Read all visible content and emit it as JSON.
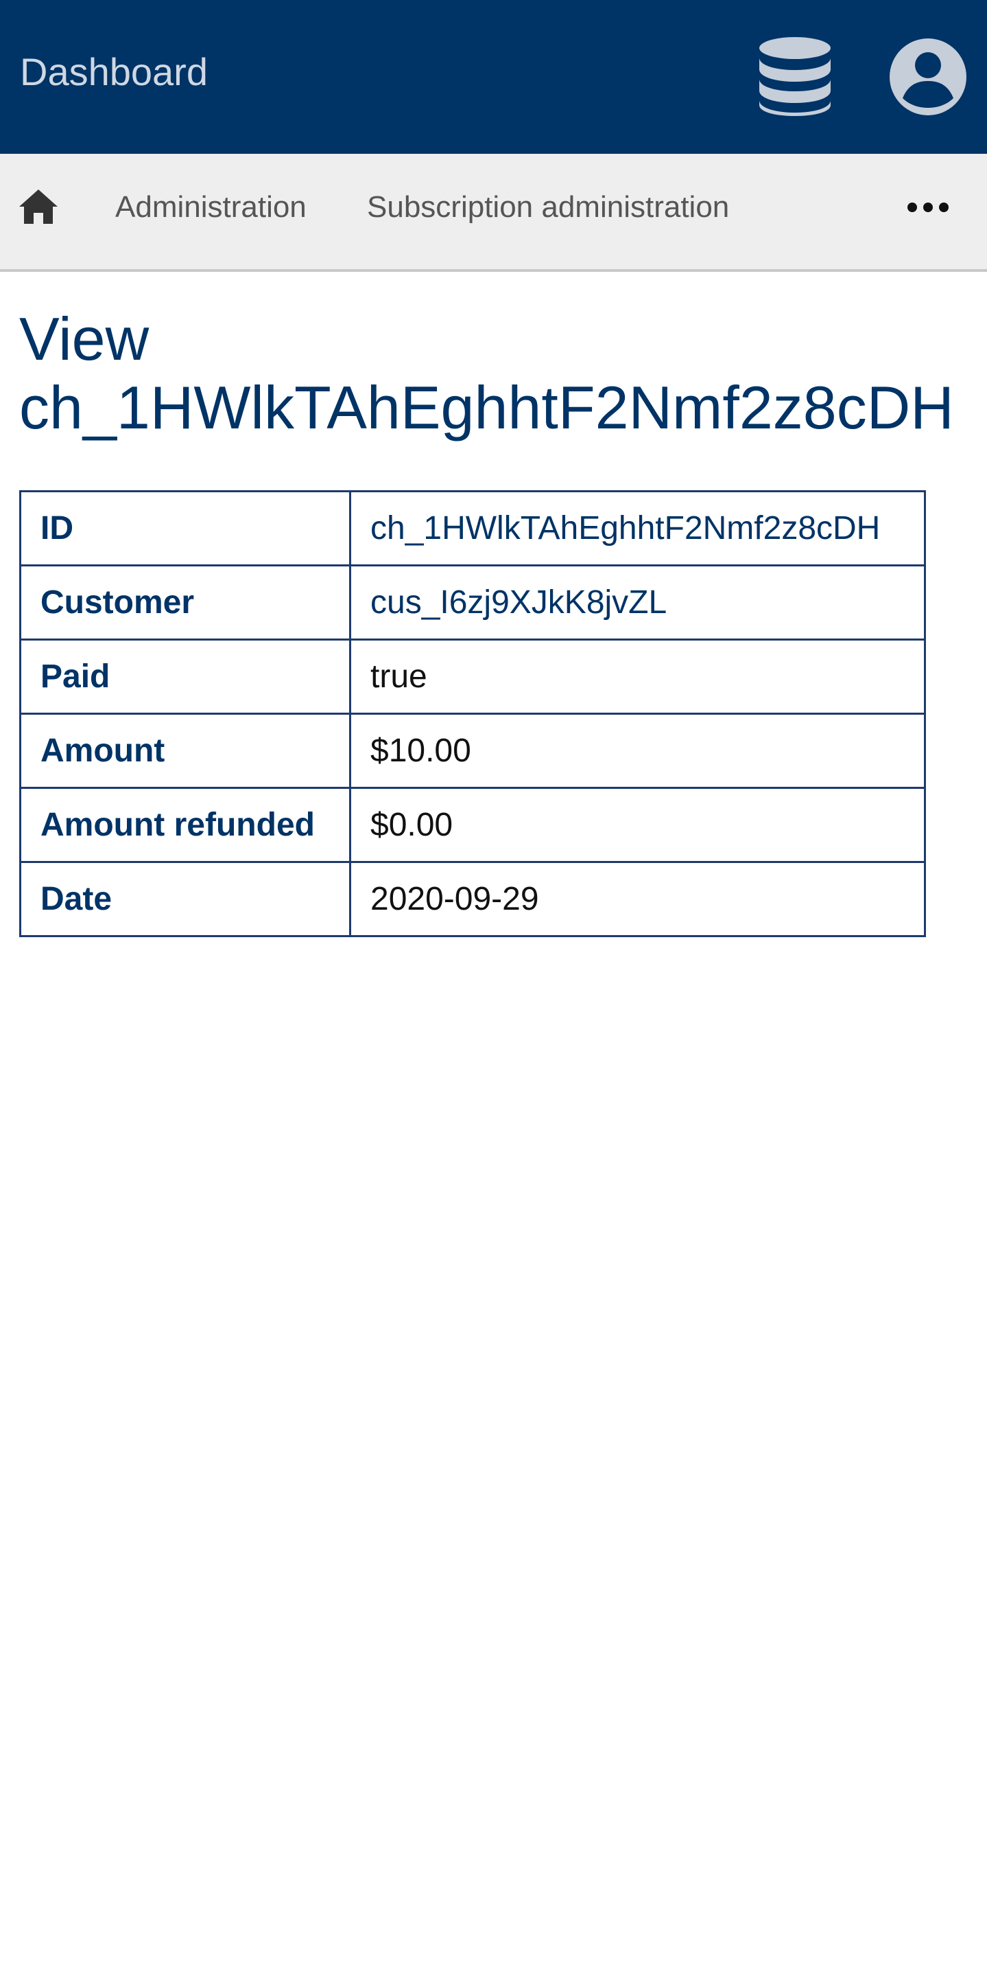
{
  "header": {
    "brand": "Dashboard",
    "db_icon": "database-icon",
    "user_icon": "user-circle-icon",
    "background": "#003366"
  },
  "nav": {
    "home_icon": "home-icon",
    "items": [
      {
        "label": "Administration"
      },
      {
        "label": "Subscription administration"
      }
    ],
    "more_icon": "ellipsis-icon"
  },
  "page": {
    "title_prefix": "View",
    "title_id": "ch_1HWlkTAhEghhtF2Nmf2z8cDH"
  },
  "details": [
    {
      "label": "ID",
      "value": "ch_1HWlkTAhEghhtF2Nmf2z8cDH",
      "link": true
    },
    {
      "label": "Customer",
      "value": "cus_I6zj9XJkK8jvZL",
      "link": true
    },
    {
      "label": "Paid",
      "value": "true",
      "link": false
    },
    {
      "label": "Amount",
      "value": "$10.00",
      "link": false
    },
    {
      "label": "Amount refunded",
      "value": "$0.00",
      "link": false
    },
    {
      "label": "Date",
      "value": "2020-09-29",
      "link": false
    }
  ]
}
